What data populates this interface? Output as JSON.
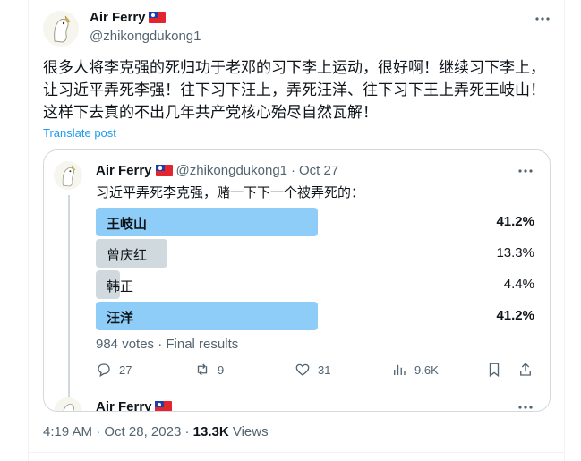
{
  "author": {
    "name": "Air Ferry",
    "handle": "@zhikongdukong1",
    "flag_icon": "taiwan-flag-icon"
  },
  "post": {
    "text": "很多人将李克强的死归功于老邓的习下李上运动，很好啊！继续习下李上，让习近平弄死李强！往下习下汪上，弄死汪洋、往下习下王上弄死王岐山！这样下去真的不出几年共产党核心殆尽自然瓦解！",
    "translate_label": "Translate post",
    "time": "4:19 AM",
    "date": "Oct 28, 2023",
    "views_count": "13.3K",
    "views_label": "Views"
  },
  "quote": {
    "name": "Air Ferry",
    "handle": "@zhikongdukong1",
    "separator": "·",
    "date": "Oct 27",
    "text": "习近平弄死李克强，赌一下下一个被弄死的：",
    "poll": {
      "options": [
        {
          "label": "王岐山",
          "pct_text": "41.2%",
          "pct": 41.2,
          "winner": true
        },
        {
          "label": "曾庆红",
          "pct_text": "13.3%",
          "pct": 13.3,
          "winner": false
        },
        {
          "label": "韩正",
          "pct_text": "4.4%",
          "pct": 4.4,
          "winner": false
        },
        {
          "label": "汪洋",
          "pct_text": "41.2%",
          "pct": 41.2,
          "winner": true
        }
      ],
      "footer": "984 votes · Final results"
    },
    "actions": {
      "replies": "27",
      "reposts": "9",
      "likes": "31",
      "views": "9.6K"
    }
  },
  "next_post": {
    "name": "Air Ferry"
  },
  "colors": {
    "accent": "#1d9bf0",
    "winner_bar": "#8ecdf8",
    "other_bar": "#cfd9de",
    "muted_text": "#536471"
  }
}
